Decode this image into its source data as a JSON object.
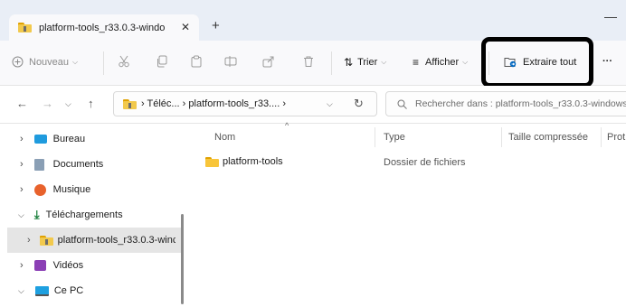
{
  "tab": {
    "title": "platform-tools_r33.0.3-windo",
    "close": "✕",
    "new_tab": "+"
  },
  "window": {
    "minimize": "—"
  },
  "toolbar": {
    "new_label": "Nouveau",
    "sort_label": "Trier",
    "view_label": "Afficher",
    "extract_label": "Extraire tout",
    "more": "···"
  },
  "address": {
    "crumbs": [
      "Téléc...",
      "platform-tools_r33...."
    ],
    "search_placeholder": "Rechercher dans : platform-tools_r33.0.3-windows."
  },
  "sidebar": {
    "items": [
      {
        "label": "Bureau",
        "icon": "desktop-icon"
      },
      {
        "label": "Documents",
        "icon": "documents-icon"
      },
      {
        "label": "Musique",
        "icon": "music-icon"
      },
      {
        "label": "Téléchargements",
        "icon": "download-icon"
      },
      {
        "label": "platform-tools_r33.0.3-winc",
        "icon": "zip-folder-icon"
      },
      {
        "label": "Vidéos",
        "icon": "video-icon"
      },
      {
        "label": "Ce PC",
        "icon": "computer-icon"
      }
    ]
  },
  "columns": {
    "name": "Nom",
    "type": "Type",
    "compressed_size": "Taille compressée",
    "protection": "Prot"
  },
  "files": [
    {
      "name": "platform-tools",
      "type": "Dossier de fichiers"
    }
  ],
  "colors": {
    "accent": "#0067c0",
    "folder": "#f8c53a",
    "highlight_border": "#000000"
  }
}
